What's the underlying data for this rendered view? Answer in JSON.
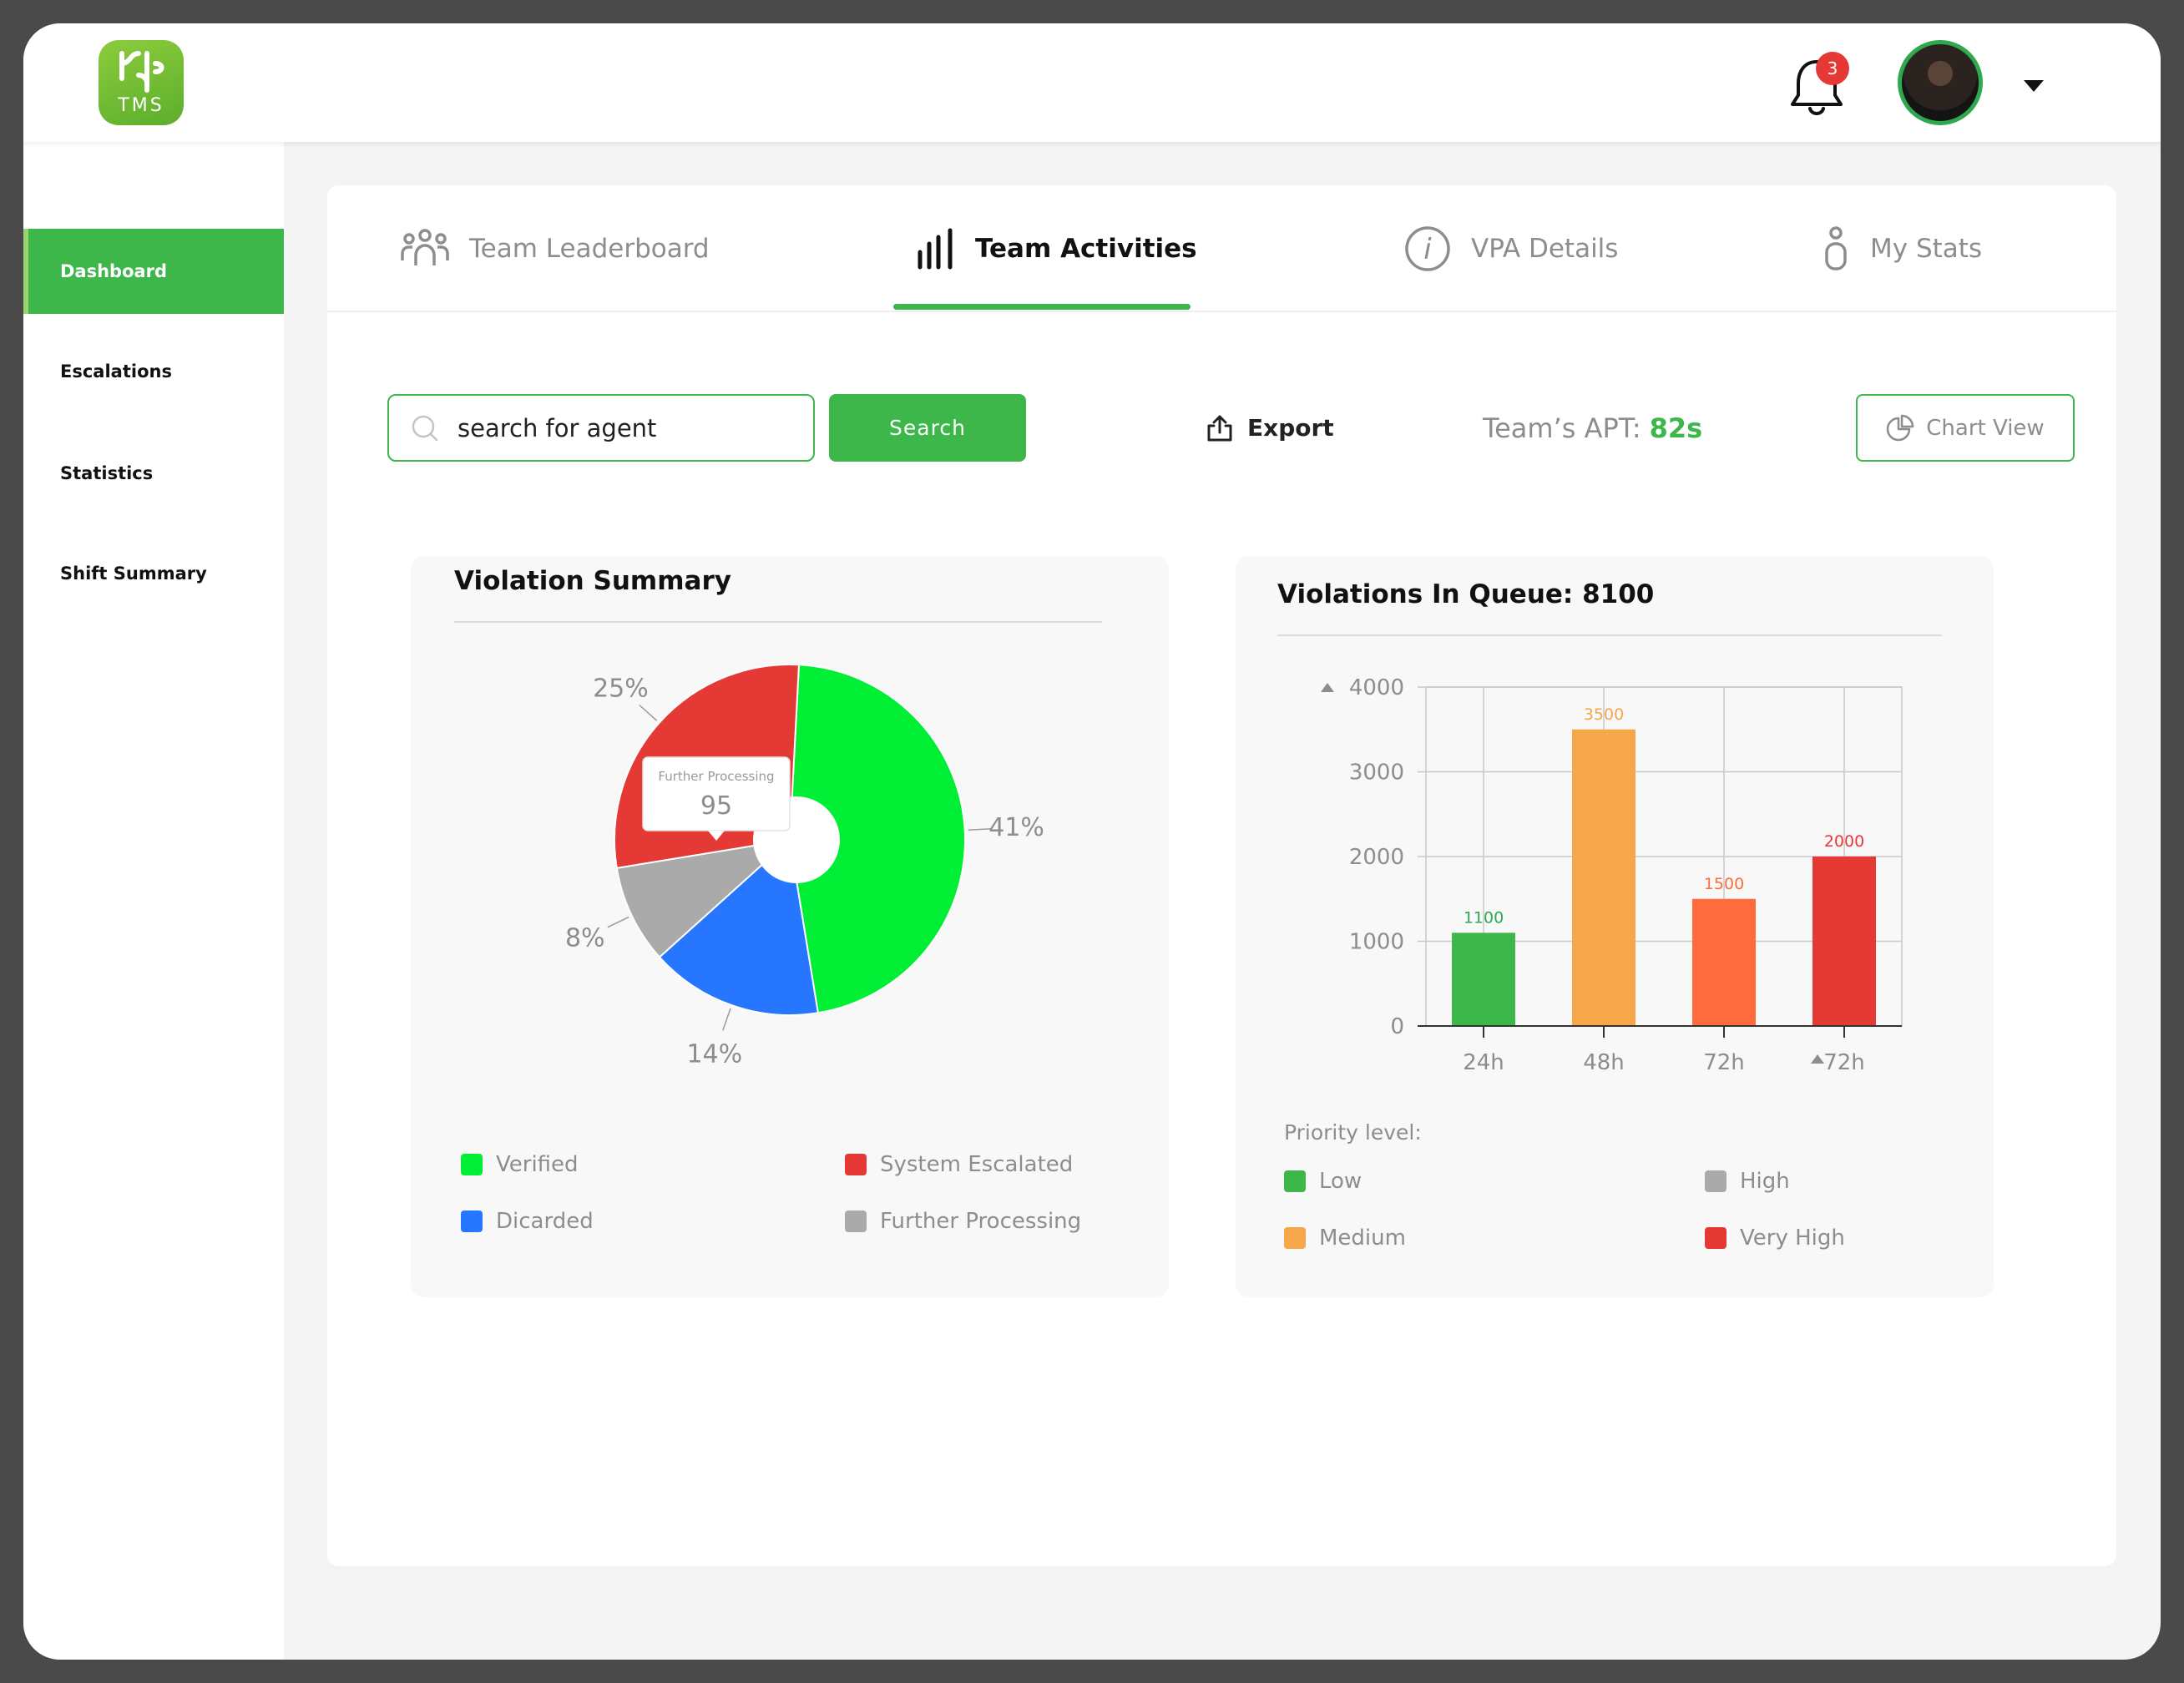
{
  "app": {
    "logo_text": "TMS",
    "notification_count": "3"
  },
  "sidebar": {
    "items": [
      {
        "label": "Dashboard",
        "active": true
      },
      {
        "label": "Escalations"
      },
      {
        "label": "Statistics"
      },
      {
        "label": "Shift Summary"
      }
    ]
  },
  "tabs": [
    {
      "label": "Team Leaderboard",
      "icon": "team-icon"
    },
    {
      "label": "Team Activities",
      "icon": "bar-chart-icon",
      "active": true
    },
    {
      "label": "VPA Details",
      "icon": "info-icon"
    },
    {
      "label": "My Stats",
      "icon": "person-icon"
    }
  ],
  "toolbar": {
    "search_placeholder": "search for agent",
    "search_button": "Search",
    "export_label": "Export",
    "apt_label": "Team’s APT:",
    "apt_value": "82s",
    "chart_view_label": "Chart View"
  },
  "colors": {
    "accent": "#3db64a"
  },
  "pie_panel": {
    "title": "Violation Summary",
    "tooltip": {
      "label": "Further Processing",
      "value": "95"
    }
  },
  "bar_panel": {
    "title": "Violations In Queue: 8100",
    "legend_title": "Priority level:"
  },
  "chart_data": [
    {
      "type": "pie",
      "title": "Violation Summary",
      "slices": [
        {
          "name": "Verified",
          "value": 41,
          "color": "#00ee33",
          "label": "41%"
        },
        {
          "name": "Dicarded",
          "value": 14,
          "color": "#2676ff",
          "label": "14%"
        },
        {
          "name": "Further Processing",
          "value": 8,
          "color": "#aaaaaa",
          "label": "8%"
        },
        {
          "name": "System Escalated",
          "value": 25,
          "color": "#e53935",
          "label": "25%"
        }
      ],
      "legend": [
        {
          "name": "Verified",
          "color": "#00ee33"
        },
        {
          "name": "System Escalated",
          "color": "#e53935"
        },
        {
          "name": "Dicarded",
          "color": "#2676ff"
        },
        {
          "name": "Further Processing",
          "color": "#aaaaaa"
        }
      ]
    },
    {
      "type": "bar",
      "title": "Violations In Queue: 8100",
      "categories": [
        "24h",
        "48h",
        "72h",
        "72h"
      ],
      "values": [
        1100,
        3500,
        1500,
        2000
      ],
      "colors": [
        "#3db64a",
        "#f5a74a",
        "#ff6b3d",
        "#e53935"
      ],
      "value_label_colors": [
        "#2fa84f",
        "#f5a74a",
        "#ff6b3d",
        "#e53935"
      ],
      "ylim": [
        0,
        4000
      ],
      "yticks": [
        "0",
        "1000",
        "2000",
        "3000",
        "4000"
      ],
      "grid": true,
      "legend_title": "Priority level:",
      "legend": [
        {
          "name": "Low",
          "color": "#3db64a"
        },
        {
          "name": "High",
          "color": "#aaaaaa"
        },
        {
          "name": "Medium",
          "color": "#f5a74a"
        },
        {
          "name": "Very High",
          "color": "#e53935"
        }
      ]
    }
  ]
}
